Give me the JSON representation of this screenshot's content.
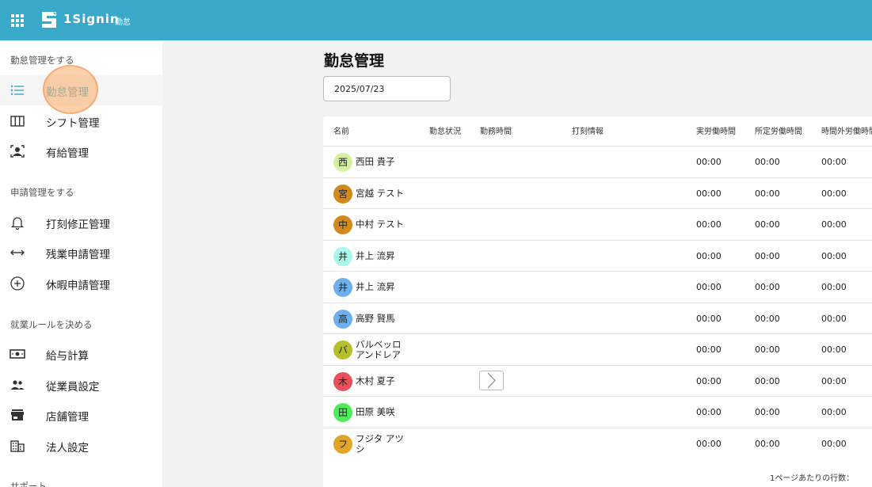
{
  "header": {
    "brand": "1Signin",
    "sub": "勤怠"
  },
  "sidebar": {
    "sections": [
      {
        "title": "勤怠管理をする",
        "items": [
          {
            "label": "勤怠管理",
            "icon": "list-icon",
            "active": true
          },
          {
            "label": "シフト管理",
            "icon": "columns-icon"
          },
          {
            "label": "有給管理",
            "icon": "person-badge-icon"
          }
        ]
      },
      {
        "title": "申請管理をする",
        "items": [
          {
            "label": "打刻修正管理",
            "icon": "bell-icon"
          },
          {
            "label": "残業申請管理",
            "icon": "arrows-horizontal-icon"
          },
          {
            "label": "休暇申請管理",
            "icon": "plus-circle-icon"
          }
        ]
      },
      {
        "title": "就業ルールを決める",
        "items": [
          {
            "label": "給与計算",
            "icon": "money-icon"
          },
          {
            "label": "従業員設定",
            "icon": "people-icon"
          },
          {
            "label": "店舗管理",
            "icon": "store-icon"
          },
          {
            "label": "法人設定",
            "icon": "building-icon"
          }
        ]
      },
      {
        "title": "サポート",
        "items": []
      }
    ]
  },
  "main": {
    "title": "勤怠管理",
    "date": "2025/07/23",
    "columns": [
      "名前",
      "勤怠状況",
      "勤務時間",
      "打刻情報",
      "実労働時間",
      "所定労働時間",
      "時間外労働時間"
    ],
    "rows": [
      {
        "initial": "西",
        "color": "#d4f0a4",
        "name": [
          "西田 貴子"
        ],
        "actual": "00:00",
        "scheduled": "00:00",
        "overtime": "00:00"
      },
      {
        "initial": "宮",
        "color": "#d38a1c",
        "name": [
          "宮越 テスト"
        ],
        "actual": "00:00",
        "scheduled": "00:00",
        "overtime": "00:00"
      },
      {
        "initial": "中",
        "color": "#d38a1c",
        "name": [
          "中村 テスト"
        ],
        "actual": "00:00",
        "scheduled": "00:00",
        "overtime": "00:00"
      },
      {
        "initial": "井",
        "color": "#a9f7ec",
        "name": [
          "井上 流昇"
        ],
        "actual": "00:00",
        "scheduled": "00:00",
        "overtime": "00:00"
      },
      {
        "initial": "井",
        "color": "#6fb0ea",
        "name": [
          "井上 流昇"
        ],
        "actual": "00:00",
        "scheduled": "00:00",
        "overtime": "00:00"
      },
      {
        "initial": "高",
        "color": "#6fb0ea",
        "name": [
          "高野 賢馬"
        ],
        "actual": "00:00",
        "scheduled": "00:00",
        "overtime": "00:00"
      },
      {
        "initial": "バ",
        "color": "#b7bf2c",
        "name": [
          "バルベッロ",
          "アンドレア"
        ],
        "actual": "00:00",
        "scheduled": "00:00",
        "overtime": "00:00"
      },
      {
        "initial": "木",
        "color": "#e8505b",
        "name": [
          "木村 夏子"
        ],
        "actual": "00:00",
        "scheduled": "00:00",
        "overtime": "00:00",
        "stamp_button": true
      },
      {
        "initial": "田",
        "color": "#4ced58",
        "name": [
          "田原 美咲"
        ],
        "actual": "00:00",
        "scheduled": "00:00",
        "overtime": "00:00"
      },
      {
        "initial": "フ",
        "color": "#e0a62a",
        "name": [
          "フジタ アツ",
          "シ"
        ],
        "actual": "00:00",
        "scheduled": "00:00",
        "overtime": "00:00"
      }
    ],
    "rows_per_page_label": "1ページあたりの行数："
  }
}
